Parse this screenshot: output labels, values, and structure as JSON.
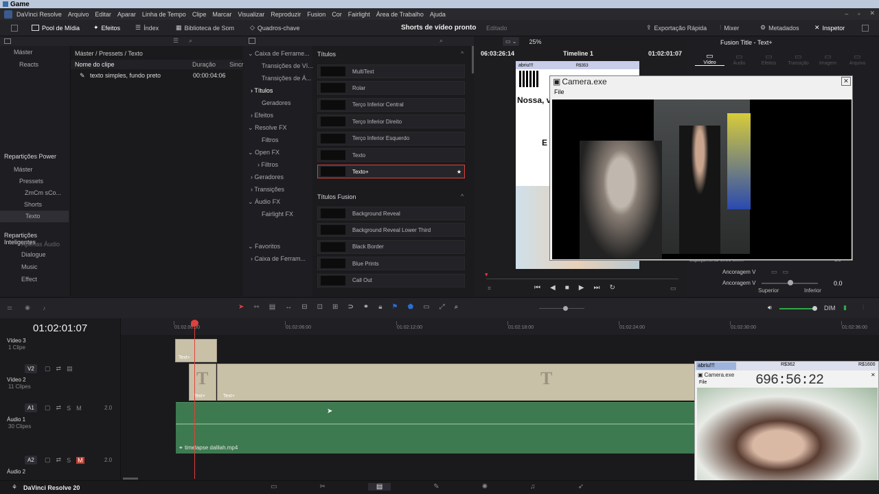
{
  "window": {
    "title": "Game"
  },
  "menu": [
    "DaVinci Resolve",
    "Arquivo",
    "Editar",
    "Aparar",
    "Linha de Tempo",
    "Clipe",
    "Marcar",
    "Visualizar",
    "Reproduzir",
    "Fusion",
    "Cor",
    "Fairlight",
    "Área de Trabalho",
    "Ajuda"
  ],
  "toolbar": {
    "media_pool": "Pool de Mídia",
    "effects": "Efeitos",
    "index": "Índex",
    "sound_library": "Biblioteca de Som",
    "keyframes": "Quadros-chave",
    "project_name": "Shorts de vídeo pronto",
    "project_status": "Editado",
    "quick_export": "Exportação Rápida",
    "mixer": "Mixer",
    "metadata": "Metadados",
    "inspector": "Inspetor"
  },
  "bins": {
    "top": [
      "Máster",
      "Reacts"
    ],
    "power_title": "Repartições Power",
    "power_items": [
      "Máster",
      "Pressets",
      "ZmCm sCo...",
      "Shorts",
      "Texto"
    ],
    "smart_title": "Repartições Inteligentes",
    "smart_items": [
      "Apenas Áudio",
      "Dialogue",
      "Music",
      "Effect"
    ]
  },
  "mediapool": {
    "breadcrumb": "Máster / Pressets / Texto",
    "col_name": "Nome do clipe",
    "col_duration": "Duração",
    "col_sync": "Sincr",
    "clip_name": "texto simples, fundo preto",
    "clip_duration": "00:00:04:06"
  },
  "fxtree": {
    "items": [
      "Caixa de Ferrame...",
      "Transições de Ví...",
      "Transições de Á...",
      "Títulos",
      "Geradores",
      "Efeitos",
      "Resolve FX",
      "Filtros",
      "Open FX",
      "Filtros",
      "Geradores",
      "Transições",
      "Áudio FX",
      "Fairlight FX",
      "Favoritos",
      "Caixa de Ferram..."
    ]
  },
  "titles": {
    "section": "Títulos",
    "items": [
      "MultiText",
      "Rolar",
      "Terço Inferior Central",
      "Terço Inferior Direito",
      "Terço Inferior Esquerdo",
      "Texto",
      "Texto+"
    ],
    "fusion_section": "Títulos Fusion",
    "fusion_items": [
      "Background Reveal",
      "Background Reveal Lower Third",
      "Black Border",
      "Blue Prints",
      "Call Out"
    ]
  },
  "viewer": {
    "timecode_left": "06:03:26:14",
    "zoom": "25%",
    "timeline_name": "Timeline 1",
    "timecode_right": "01:02:01:07"
  },
  "inspector": {
    "title": "Fusion Title - Text+",
    "tabs": [
      "Vídeo",
      "Áudio",
      "Efeitos",
      "Transição",
      "Imagem",
      "Arquivo"
    ],
    "anchor_h": "Ancoragem V",
    "anchor_v": "Ancoragem V",
    "top_label": "Superior",
    "bottom_label": "Inferior",
    "value": "0.0",
    "value2": "1.0",
    "spacing_label": "Espaçamento entre linh..."
  },
  "camera_window": {
    "title": "Camera.exe",
    "menu": "File"
  },
  "timeline": {
    "timecode": "01:02:01:07",
    "ruler": [
      "01:02:00:00",
      "01:02:06:00",
      "01:02:12:00",
      "01:02:18:00",
      "01:02:24:00",
      "01:02:30:00",
      "01:02:36:00"
    ],
    "tracks": [
      {
        "name": "Vídeo 3",
        "info": "1 Clipe",
        "tag": ""
      },
      {
        "name": "Vídeo 2",
        "info": "11 Clipes",
        "tag": "V2"
      },
      {
        "name": "Áudio 1",
        "info": "30 Clipes",
        "tag": "A1",
        "level": "2.0"
      },
      {
        "name": "Áudio 2",
        "info": "",
        "tag": "A2",
        "level": "2.0"
      }
    ],
    "text_clip_label": "Text+",
    "audio_clip": "timelapse dalilah.mp4",
    "dim": "DIM"
  },
  "overlay_stream": {
    "label1": "abriu!!!",
    "label2": "R$362",
    "label3": "R$1600",
    "camera_title": "Camera.exe",
    "file": "File",
    "counter": "696:56:22"
  },
  "preview_stream": {
    "label1": "abriu!!!",
    "label2": "R$353",
    "text1": "Nossa, v",
    "text2": "E"
  },
  "bottom": {
    "app": "DaVinci Resolve 20"
  },
  "colors": {
    "accent_red": "#e0403c",
    "audio_green": "#3d7a50",
    "playhead": "#e0403c",
    "text_clip": "#c9c0a8"
  }
}
